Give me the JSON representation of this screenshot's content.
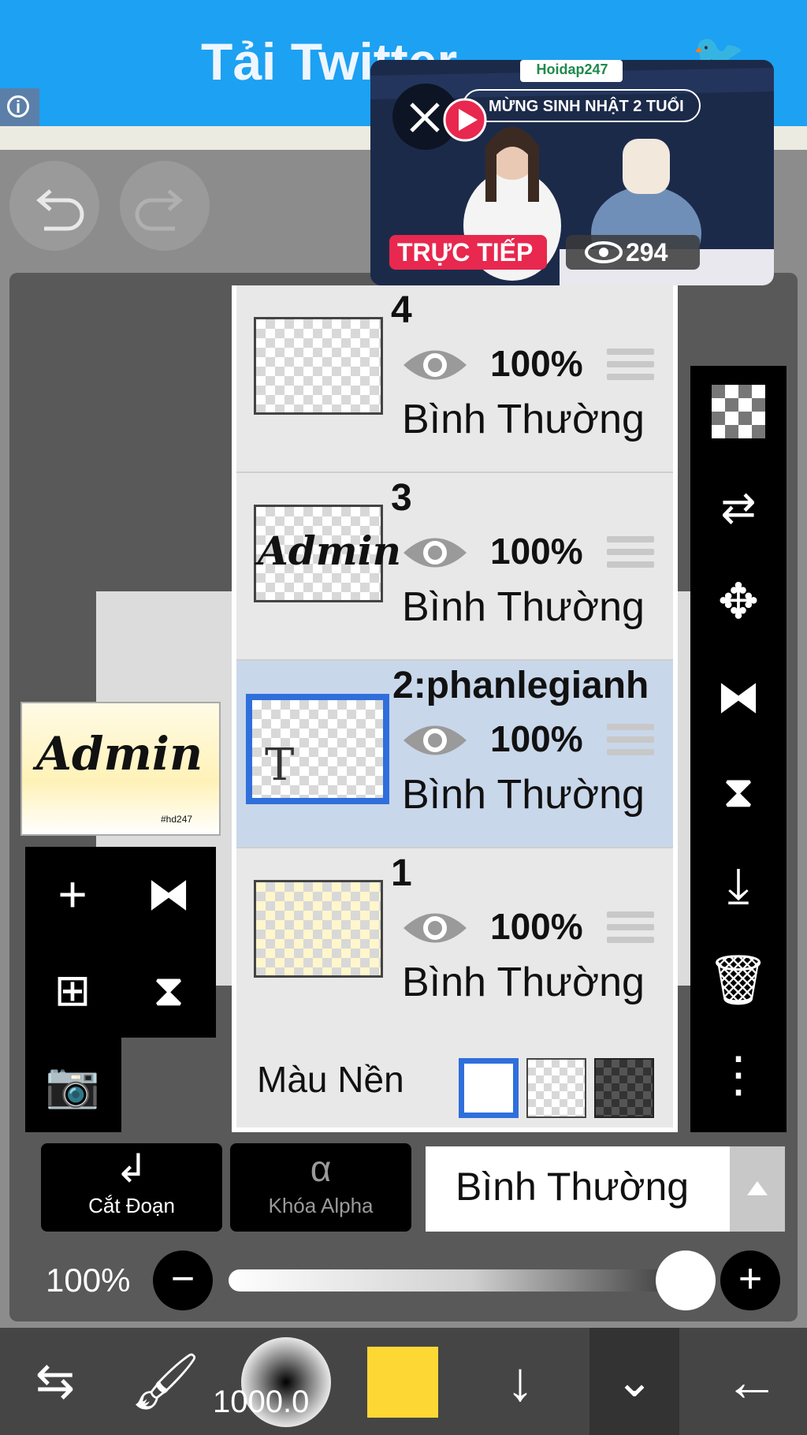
{
  "ad": {
    "title": "Tải Twitter",
    "info_icon": "info-icon",
    "bird_icon": "twitter-bird-icon"
  },
  "video_overlay": {
    "brand": "Hoidap247",
    "headline": "MỪNG SINH NHẬT 2 TUỔI",
    "live_badge": "TRỰC TIẾP",
    "viewer_count": "294",
    "close_icon": "close-icon",
    "live_color": "#e8284e"
  },
  "toolbar_top": {
    "undo_icon": "undo-icon",
    "redo_icon": "redo-icon"
  },
  "layers": [
    {
      "name": "4",
      "opacity": "100%",
      "blend": "Bình Thường",
      "selected": false
    },
    {
      "name": "3",
      "opacity": "100%",
      "blend": "Bình Thường",
      "selected": false,
      "thumb_text": "Admin"
    },
    {
      "name": "2:phanlegianh",
      "opacity": "100%",
      "blend": "Bình Thường",
      "selected": true,
      "thumb_text": "T"
    },
    {
      "name": "1",
      "opacity": "100%",
      "blend": "Bình Thường",
      "selected": false
    }
  ],
  "background_row": {
    "label": "Màu Nền",
    "selected_option": "white"
  },
  "preview": {
    "text": "Admin",
    "caption": "#hd247"
  },
  "bottom_controls": {
    "clip_label": "Cắt Đoạn",
    "alpha_lock_label": "Khóa Alpha",
    "blend_mode": "Bình Thường",
    "opacity_label": "100%",
    "opacity_value": 1.0
  },
  "bottom_bar": {
    "brush_size": "1000.0",
    "current_color": "#fdd835"
  },
  "colors": {
    "accent_blue": "#2f6fdc",
    "ad_blue": "#1da1f2",
    "selected_layer_bg": "#c9d7ea"
  }
}
